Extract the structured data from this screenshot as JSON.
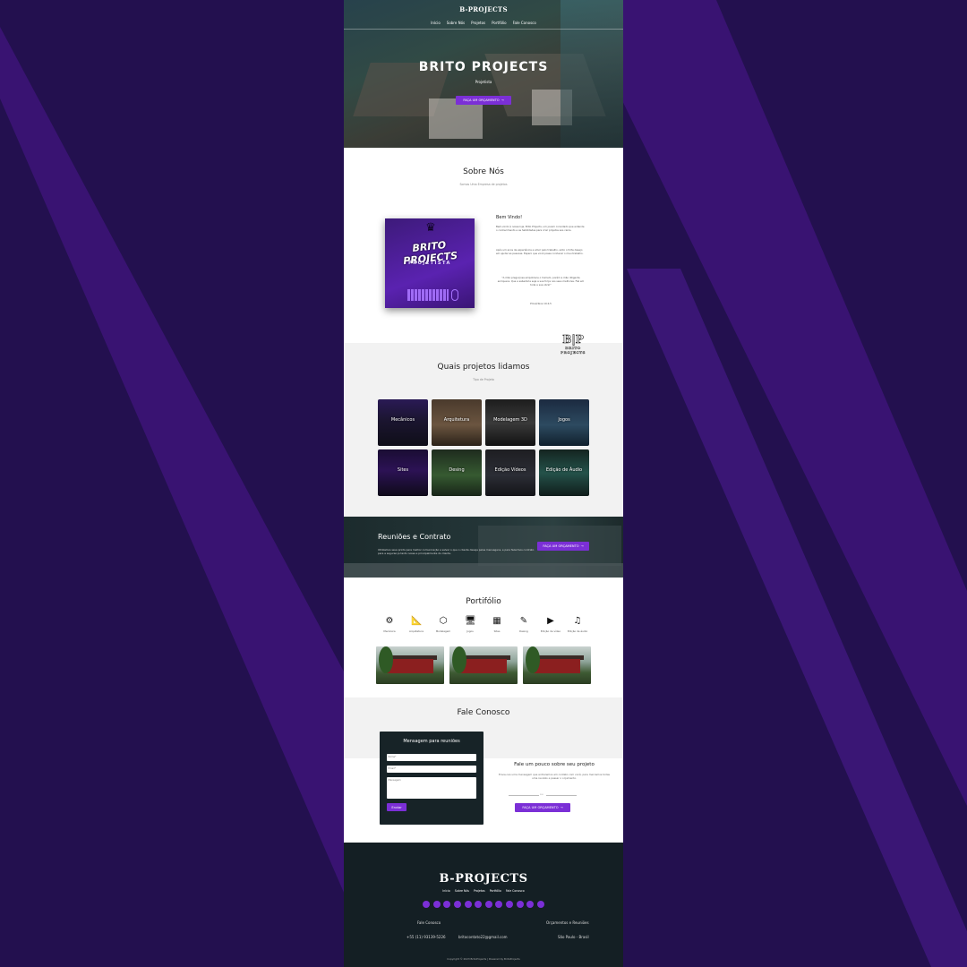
{
  "colors": {
    "background": "#2a0f5c",
    "stripe": "#3d1478",
    "accent": "#7b2fd6",
    "footer": "#141f24",
    "form": "#172327"
  },
  "header": {
    "brand": "B-PROJECTS",
    "nav": [
      "Início",
      "Sobre Nós",
      "Projetos",
      "Portfólio",
      "Fale Conosco"
    ]
  },
  "hero": {
    "title": "BRITO PROJECTS",
    "subtitle": "Projetista",
    "cta": "FAÇA UM ORÇAMENTO"
  },
  "about": {
    "title": "Sobre Nós",
    "subtitle": "Somos Uma Empresa de projetos",
    "cover_title": "BRITO PROJECTS",
    "cover_subtitle": "PROJETISTA",
    "heading": "Bem Vindo!",
    "p1": "Bem-vindo à nossa loja, Brito Projects, um jovem convidado que entende o conhecimento e as habilidades para criar projetos aos caros.",
    "p2": "Após um anos de experiência e amor pelo trabalho, sinto o forte desejo em ajudar as pessoas. Espero que você possa conhecer o meu trabalho.",
    "quote": "\"A mão preguiçosa empobrece o homem, porém a mão diligente enriquece. Que a sabedoria seja a sua força nos seus melhores. Fiel em toda a sua obra!\"",
    "author": "Provérbios 10:4-5"
  },
  "watermark": {
    "logo": "B|P",
    "text": "BRITO PROJECTS"
  },
  "projects": {
    "title": "Quais projetos lidamos",
    "subtitle": "Tipo de Projeto",
    "tiles": [
      {
        "label": "Mecânicos",
        "bg": "linear-gradient(180deg,#2a1a55,#1b1530 45%,#0f0e18)"
      },
      {
        "label": "Arquitetura",
        "bg": "linear-gradient(180deg,#4a3a2c,#6b5540 55%,#2b2219)"
      },
      {
        "label": "Modelagem 3D",
        "bg": "linear-gradient(180deg,#1d1d1d,#3a3a3a 50%,#121212)"
      },
      {
        "label": "Jogos",
        "bg": "linear-gradient(180deg,#1b2a40,#2d4a60 55%,#10202c)"
      },
      {
        "label": "Sites",
        "bg": "linear-gradient(180deg,#1a0d33,#2c1255 45%,#0e0a18)"
      },
      {
        "label": "Desing",
        "bg": "linear-gradient(180deg,#1e2b1e,#365a31 55%,#182418)"
      },
      {
        "label": "Edição Vídeos",
        "bg": "linear-gradient(180deg,#1e1e22,#2b2d35 55%,#141418)"
      },
      {
        "label": "Edição de Áudio",
        "bg": "linear-gradient(180deg,#142420,#24524a 50%,#101c1a)"
      }
    ]
  },
  "meetings": {
    "title": "Reuniões e Contrato",
    "text": "Utilizamos seus prints para melhor comunicação e salvar o que o cliente deseja pelas mensagens, e para fazermos contrato para a segurança tanto nossa e principalmente do cliente.",
    "cta": "FAÇA UM ORÇAMENTO"
  },
  "portfolio": {
    "title": "Portifólio",
    "icons": [
      {
        "label": "Mecânica",
        "icon": "gears-icon",
        "glyph": "⚙"
      },
      {
        "label": "Arquitetura",
        "icon": "compass-icon",
        "glyph": "📐"
      },
      {
        "label": "Modelagem",
        "icon": "cube-icon",
        "glyph": "⬡"
      },
      {
        "label": "Jogos",
        "icon": "gamepad-icon",
        "glyph": "🖥"
      },
      {
        "label": "Sites",
        "icon": "website-icon",
        "glyph": "▦"
      },
      {
        "label": "Desing",
        "icon": "design-icon",
        "glyph": "✎"
      },
      {
        "label": "Edição de vídeo",
        "icon": "video-icon",
        "glyph": "▶"
      },
      {
        "label": "Edição de áudio",
        "icon": "audio-icon",
        "glyph": "♫"
      }
    ]
  },
  "contact": {
    "title": "Fale Conosco",
    "form_title": "Mensagem para reuniões",
    "name_placeholder": "Nome*",
    "email_placeholder": "Email*",
    "message_placeholder": "Mensagem",
    "send": "Enviar",
    "right_heading": "Fale um pouco sobre seu projeto",
    "right_text": "Envie-nos uma mensagem que entraremos em contato com você, para marcamos todas uma reunião e passar o orçamento.",
    "divider": "ou",
    "cta": "FAÇA UM ORÇAMENTO"
  },
  "footer": {
    "brand": "B-PROJECTS",
    "nav": [
      "Início",
      "Sobre Nós",
      "Projetos",
      "Portfólio",
      "Fale Conosco"
    ],
    "col1": "Fale Conosco",
    "col2": "Orçamentos e Reuniões",
    "phone": "+55 (11) 93139-5226",
    "email": "britocontato22@gmail.com",
    "location": "São Paulo - Brasil",
    "copyright": "Copyright © 2023 BritoProjects | Powered by BritoProjects"
  }
}
